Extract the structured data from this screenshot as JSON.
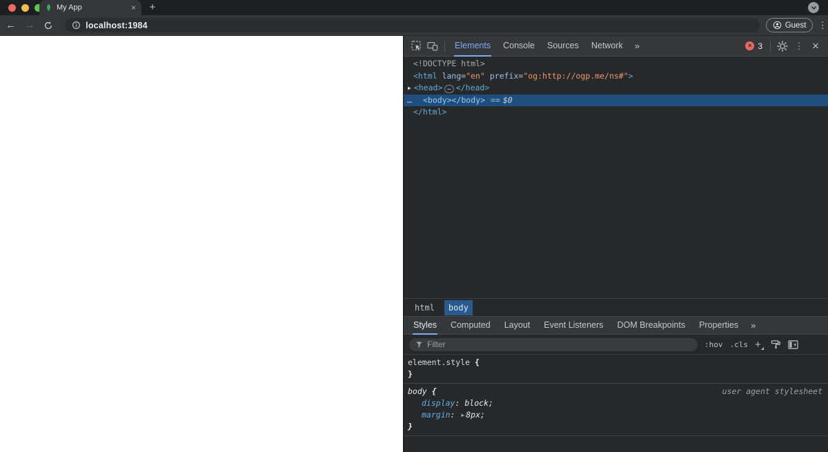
{
  "colors": {
    "accent_blue": "#7cacf8",
    "selection_blue": "#1d4e7e",
    "error_red": "#e46962",
    "tag_blue": "#5db0d7",
    "attr_value_orange": "#e8986c",
    "toolbar_grey": "#363739",
    "devtools_bg": "#27282a",
    "leaf_green": "#3eb872"
  },
  "icons": {
    "tab_close": "×",
    "new_tab": "+",
    "back": "←",
    "forward": "→",
    "kebab": "⋮",
    "devtools_close": "×",
    "error_x": "×",
    "expand_triangle": "▶",
    "gutter_dots": "…",
    "head_ellipsis": "…",
    "more_tabs": "»",
    "more_style_tabs": "»"
  },
  "window": {
    "tab_title": "My App",
    "url": "localhost:1984",
    "guest_label": "Guest"
  },
  "devtools": {
    "toolbar": {
      "tabs": [
        {
          "label": "Elements"
        },
        {
          "label": "Console"
        },
        {
          "label": "Sources"
        },
        {
          "label": "Network"
        }
      ],
      "error_count": "3"
    },
    "tree": {
      "doctype": "<!DOCTYPE html>",
      "html_open_tag": "<html",
      "attr1_name": "lang",
      "attr1_eq": "=",
      "attr1_value": "\"en\"",
      "attr2_name": "prefix",
      "attr2_eq": "=",
      "attr2_value": "\"og:http://ogp.me/ns#\"",
      "html_open_close": ">",
      "head_open": "<head>",
      "head_close": "</head>",
      "body_text": "<body></body>",
      "body_eq": "==",
      "body_ref": "$0",
      "html_close": "</html>"
    },
    "breadcrumb": [
      {
        "label": "html"
      },
      {
        "label": "body"
      }
    ],
    "style_tabs": [
      {
        "label": "Styles"
      },
      {
        "label": "Computed"
      },
      {
        "label": "Layout"
      },
      {
        "label": "Event Listeners"
      },
      {
        "label": "DOM Breakpoints"
      },
      {
        "label": "Properties"
      }
    ],
    "filter": {
      "placeholder": "Filter",
      "hov": ":hov",
      "cls": ".cls",
      "plus": "+"
    },
    "styles": {
      "inline": {
        "selector": "element.style",
        "open": "{",
        "close": "}"
      },
      "rule": {
        "selector": "body",
        "open": "{",
        "origin": "user agent stylesheet",
        "prop1_name": "display",
        "prop1_colon": ":",
        "prop1_value": "block;",
        "prop2_name": "margin",
        "prop2_colon": ":",
        "prop2_value": "8px;",
        "close": "}"
      }
    }
  }
}
